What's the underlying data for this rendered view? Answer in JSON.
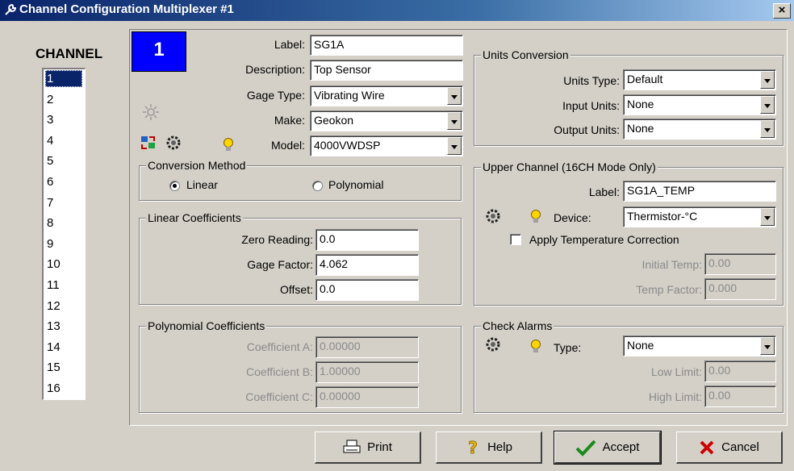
{
  "window": {
    "title": "Channel Configuration Multiplexer #1",
    "close_label": "×"
  },
  "channel": {
    "heading": "CHANNEL",
    "current": "1",
    "items": [
      "1",
      "2",
      "3",
      "4",
      "5",
      "6",
      "7",
      "8",
      "9",
      "10",
      "11",
      "12",
      "13",
      "14",
      "15",
      "16"
    ]
  },
  "general": {
    "label_caption": "Label:",
    "label_value": "SG1A",
    "description_caption": "Description:",
    "description_value": "Top Sensor",
    "gage_type_caption": "Gage Type:",
    "gage_type_value": "Vibrating Wire",
    "make_caption": "Make:",
    "make_value": "Geokon",
    "model_caption": "Model:",
    "model_value": "4000VWDSP"
  },
  "conversion_method": {
    "title": "Conversion Method",
    "linear_label": "Linear",
    "polynomial_label": "Polynomial",
    "selected": "Linear"
  },
  "linear_coefficients": {
    "title": "Linear Coefficients",
    "zero_reading_caption": "Zero Reading:",
    "zero_reading_value": "0.0",
    "gage_factor_caption": "Gage Factor:",
    "gage_factor_value": "4.062",
    "offset_caption": "Offset:",
    "offset_value": "0.0"
  },
  "polynomial_coefficients": {
    "title": "Polynomial Coefficients",
    "a_caption": "Coefficient A:",
    "a_value": "0.00000",
    "b_caption": "Coefficient B:",
    "b_value": "1.00000",
    "c_caption": "Coefficient C:",
    "c_value": "0.00000"
  },
  "units_conversion": {
    "title": "Units Conversion",
    "units_type_caption": "Units Type:",
    "units_type_value": "Default",
    "input_units_caption": "Input Units:",
    "input_units_value": "None",
    "output_units_caption": "Output Units:",
    "output_units_value": "None"
  },
  "upper_channel": {
    "title": "Upper Channel (16CH Mode Only)",
    "label_caption": "Label:",
    "label_value": "SG1A_TEMP",
    "device_caption": "Device:",
    "device_value": "Thermistor-°C",
    "apply_temp_label": "Apply Temperature Correction",
    "initial_temp_caption": "Initial Temp:",
    "initial_temp_value": "0.00",
    "temp_factor_caption": "Temp Factor:",
    "temp_factor_value": "0.000"
  },
  "check_alarms": {
    "title": "Check Alarms",
    "type_caption": "Type:",
    "type_value": "None",
    "low_limit_caption": "Low Limit:",
    "low_limit_value": "0.00",
    "high_limit_caption": "High Limit:",
    "high_limit_value": "0.00"
  },
  "buttons": {
    "print": "Print",
    "help": "Help",
    "accept": "Accept",
    "cancel": "Cancel"
  },
  "colors": {
    "title_bar": "#0a246a",
    "face": "#d4d0c8",
    "channel_badge": "#0000ff",
    "accept_check": "#1a8a1a",
    "cancel_x": "#cc0000"
  }
}
